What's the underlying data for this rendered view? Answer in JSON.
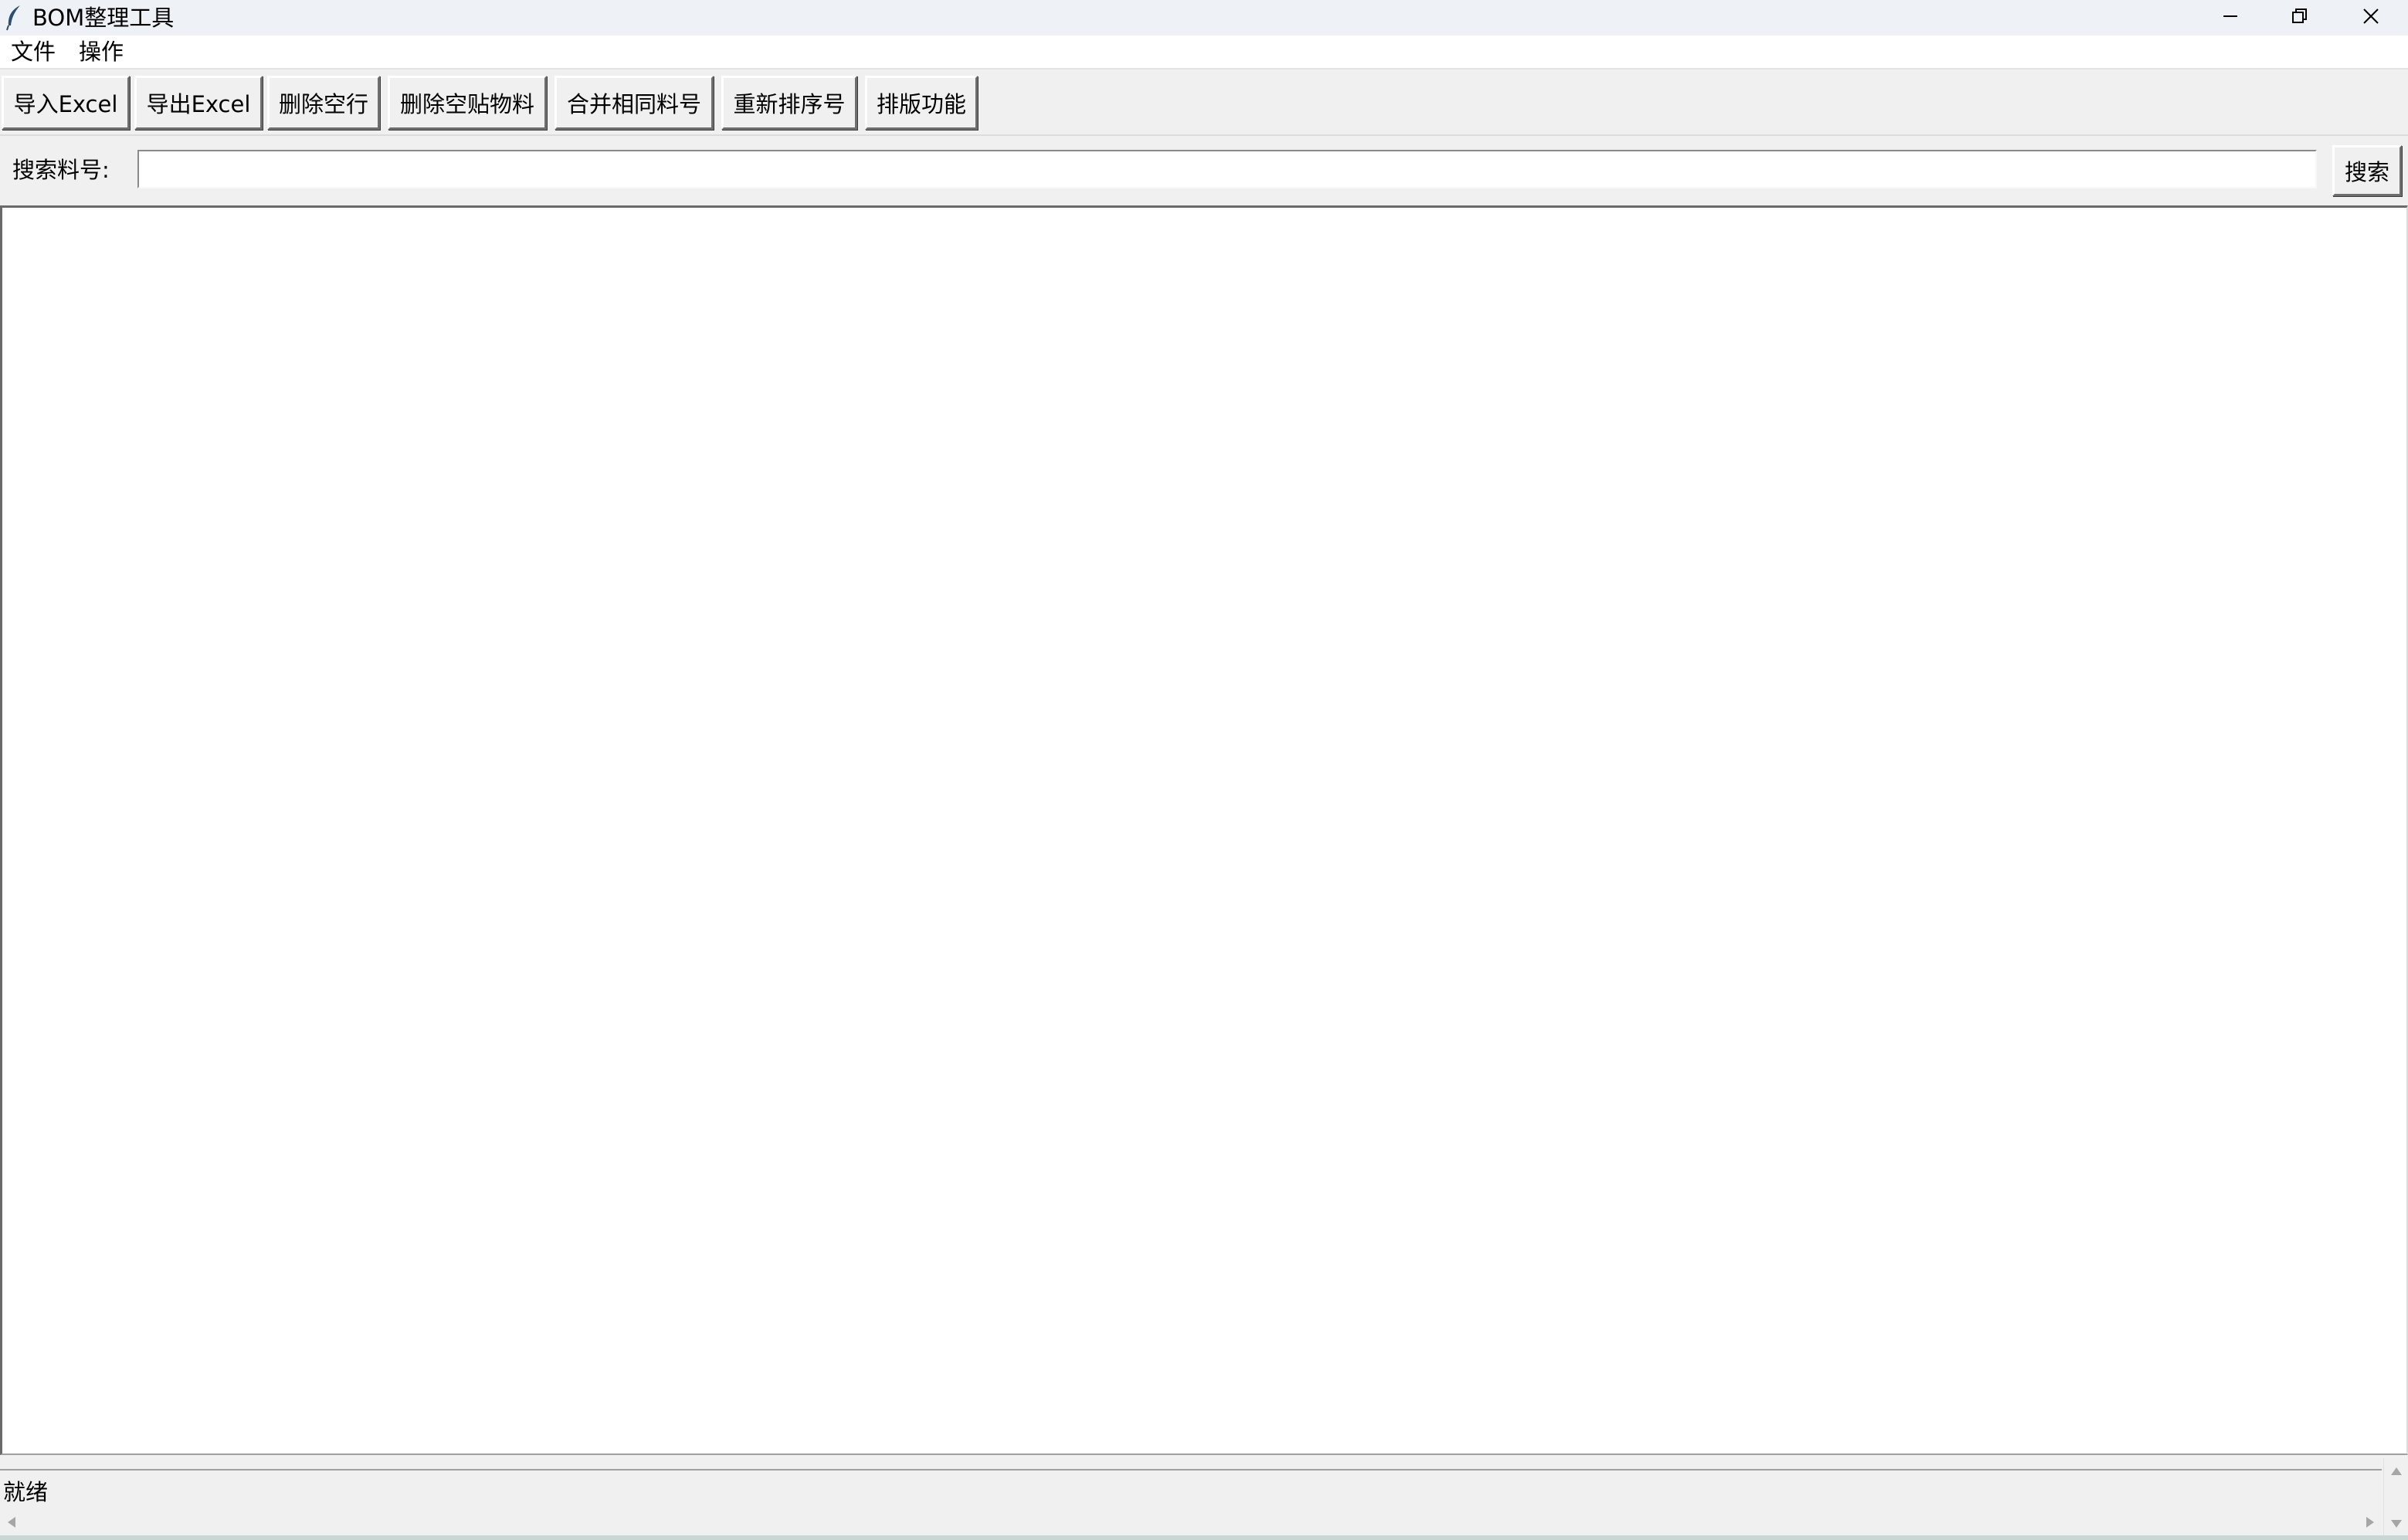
{
  "window": {
    "title": "BOM整理工具",
    "controls": {
      "minimize_icon": "minimize-icon",
      "maximize_icon": "restore-icon",
      "close_icon": "close-icon"
    }
  },
  "menubar": {
    "items": [
      {
        "label": "文件"
      },
      {
        "label": "操作"
      }
    ]
  },
  "toolbar": {
    "buttons": [
      {
        "label": "导入Excel"
      },
      {
        "label": "导出Excel"
      },
      {
        "label": "删除空行"
      },
      {
        "label": "删除空贴物料"
      },
      {
        "label": "合并相同料号"
      },
      {
        "label": "重新排序号"
      },
      {
        "label": "排版功能"
      }
    ]
  },
  "search": {
    "label": "搜索料号:",
    "value": "",
    "button_label": "搜索"
  },
  "status": {
    "text": "就绪"
  },
  "colors": {
    "window_bg": "#f0f0f0",
    "titlebar_bg": "#eef2f6",
    "content_bg": "#ffffff",
    "app_icon": "#2f4f6f"
  }
}
